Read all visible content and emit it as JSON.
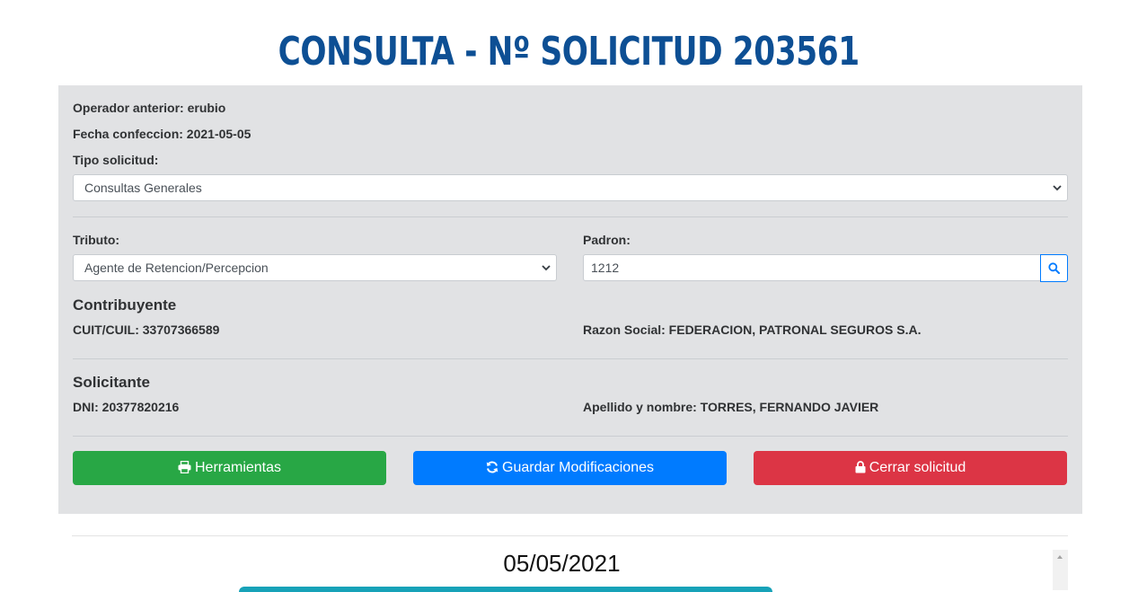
{
  "header": {
    "title": "CONSULTA - Nº SOLICITUD 203561"
  },
  "form": {
    "operador_label": "Operador anterior: erubio",
    "fecha_label": "Fecha confeccion: 2021-05-05",
    "tipo_label": "Tipo solicitud:",
    "tipo_value": "Consultas Generales",
    "tributo_label": "Tributo:",
    "tributo_value": "Agente de Retencion/Percepcion",
    "padron_label": "Padron:",
    "padron_value": "1212"
  },
  "contribuyente": {
    "title": "Contribuyente",
    "cuit": "CUIT/CUIL: 33707366589",
    "razon_social": "Razon Social: FEDERACION, PATRONAL SEGUROS S.A."
  },
  "solicitante": {
    "title": "Solicitante",
    "dni": "DNI: 20377820216",
    "apellido": "Apellido y nombre: TORRES, FERNANDO JAVIER"
  },
  "actions": {
    "herramientas": "Herramientas",
    "guardar": "Guardar Modificaciones",
    "cerrar": "Cerrar solicitud"
  },
  "timeline": {
    "date": "05/05/2021"
  },
  "colors": {
    "title": "#0d4f94",
    "panel": "#e1e2e4",
    "green": "#28a745",
    "blue": "#007bff",
    "red": "#dc3545",
    "teal": "#17a2b8"
  },
  "icons": [
    "print-icon",
    "refresh-icon",
    "lock-icon",
    "search-icon",
    "chevron-down-icon"
  ]
}
